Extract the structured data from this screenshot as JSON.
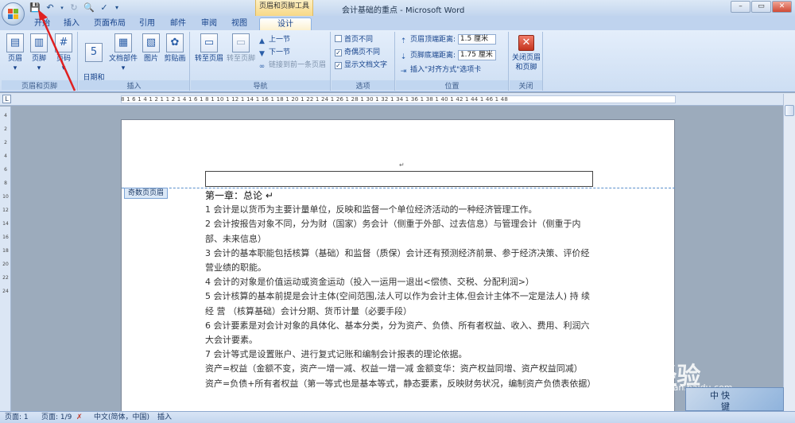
{
  "window": {
    "title": "会计基础的重点 - Microsoft Word",
    "context_tab": "页眉和页脚工具",
    "controls": [
      "–",
      "▭",
      "✕"
    ]
  },
  "tabs": [
    "开始",
    "插入",
    "页面布局",
    "引用",
    "邮件",
    "审阅",
    "视图",
    "设计"
  ],
  "ribbon": {
    "group_header_footer": {
      "label": "页眉和页脚",
      "buttons": [
        "页眉",
        "页脚",
        "页码"
      ]
    },
    "group_insert": {
      "label": "插入",
      "buttons": [
        "日期和\n时间",
        "文档部件",
        "图片",
        "剪贴画"
      ]
    },
    "group_nav": {
      "label": "导航",
      "buttons": [
        "转至页眉",
        "转至页脚"
      ],
      "prev": "上一节",
      "next": "下一节",
      "link_prev": "链接到前一条页眉"
    },
    "group_options": {
      "label": "选项",
      "items": [
        {
          "label": "首页不同",
          "checked": false
        },
        {
          "label": "奇偶页不同",
          "checked": true
        },
        {
          "label": "显示文档文字",
          "checked": true
        }
      ]
    },
    "group_position": {
      "label": "位置",
      "header_dist_label": "页眉顶端距离:",
      "header_dist": "1.5 厘米",
      "footer_dist_label": "页脚底端距离:",
      "footer_dist": "1.75 厘米",
      "insert_align_tab": "插入\"对齐方式\"选项卡"
    },
    "group_close": {
      "label": "关闭",
      "button": "关闭页眉和页脚"
    }
  },
  "ruler": {
    "numbers": "8 1 6 1 4 1 2 1 1 2 1 4 1 6 1 8 1 10 1 12 1 14 1 16 1 18 1 20 1 22 1 24 1 26 1 28 1 30 1 32 1 34 1 36 1 38 1 40 1 42 1 44 1 46 1 48",
    "vertical_numbers": [
      "4",
      "2",
      "2",
      "4",
      "6",
      "8",
      "10",
      "12",
      "14",
      "16",
      "18",
      "20",
      "22",
      "24"
    ]
  },
  "document": {
    "header_label": "奇数页页眉",
    "heading": "第一章：总论",
    "paragraphs": [
      "1 会计是以货币为主要计量单位，反映和监督一个单位经济活动的一种经济管理工作。",
      "2 会计按报告对象不同，分为财（国家）务会计（侧重于外部、过去信息）与管理会计（侧重于内部、未来信息）",
      "3 会计的基本职能包括核算（基础）和监督（质保）会计还有预测经济前景、参于经济决策、评价经营业绩的职能。",
      "4 会计的对象是价值运动或资金运动（投入一运用一退出<偿债、交税、分配利润>）",
      "5 会计核算的基本前提是会计主体(空间范围,法人可以作为会计主体,但会计主体不一定是法人) 持 续 经 营 （核算基础）会计分期、货币计量（必要手段）",
      "6 会计要素是对会计对象的具体化、基本分类，分为资产、负债、所有者权益、收入、费用、利润六大会计要素。",
      "7 会计等式是设置账户、进行复式记账和编制会计报表的理论依据。",
      "资产=权益（金额不变，资产一增一减、权益一增一减 金额变华：资产权益同增、资产权益同减）",
      "资产=负债+所有者权益（第一等式也是基本等式，静态要素，反映财务状况，编制资产负债表依据）"
    ]
  },
  "status": {
    "page": "页面: 1",
    "pages": "页面: 1/9",
    "lang": "中文(简体，中国)",
    "mode": "插入"
  },
  "watermark": {
    "brand": "Bai经验",
    "url": "jingyan.baidu.com",
    "corner": [
      "中",
      "快",
      "键"
    ]
  },
  "colors": {
    "accent": "#15428b",
    "ribbon_bg": "#dbe7f7",
    "arrow": "#e02020"
  }
}
